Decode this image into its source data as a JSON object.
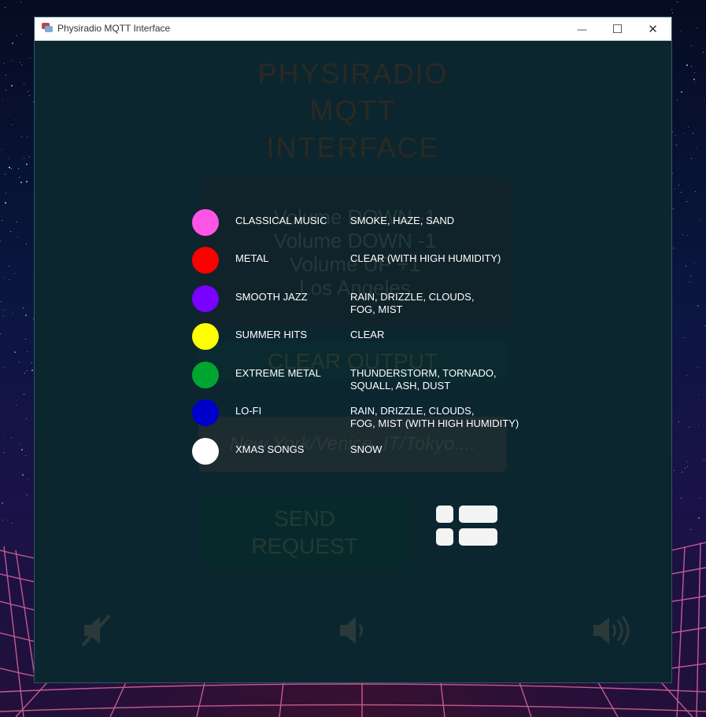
{
  "window": {
    "title": "Physiradio MQTT Interface",
    "minimize_glyph": "—",
    "maximize_glyph": "☐",
    "close_glyph": "✕"
  },
  "app": {
    "title_lines": [
      "PHYSIRADIO",
      "MQTT",
      "INTERFACE"
    ],
    "output_lines": [
      "Volume DOWN -1",
      "Volume DOWN -1",
      "Volume UP +1",
      "Los Angeles"
    ],
    "clear_button": "CLEAR OUTPUT",
    "city_input_placeholder": "New York/Venice, IT/Tokyo....",
    "send_button_lines": [
      "SEND",
      "REQUEST"
    ],
    "icons": {
      "mute": "volume-mute-icon",
      "down": "volume-down-icon",
      "up": "volume-up-icon",
      "legend_toggle": "list-view-icon"
    }
  },
  "legend": [
    {
      "color": "#ff55e6",
      "genre": "CLASSICAL MUSIC",
      "weather": "SMOKE, HAZE, SAND"
    },
    {
      "color": "#ff0000",
      "genre": "METAL",
      "weather": "CLEAR (WITH HIGH HUMIDITY)"
    },
    {
      "color": "#7a00ff",
      "genre": "SMOOTH JAZZ",
      "weather": "RAIN, DRIZZLE, CLOUDS,\nFOG, MIST"
    },
    {
      "color": "#ffff00",
      "genre": "SUMMER HITS",
      "weather": "CLEAR"
    },
    {
      "color": "#00a530",
      "genre": "EXTREME METAL",
      "weather": "THUNDERSTORM, TORNADO,\nSQUALL, ASH, DUST"
    },
    {
      "color": "#0000cc",
      "genre": "LO-FI",
      "weather": "RAIN, DRIZZLE, CLOUDS,\nFOG, MIST (WITH HIGH HUMIDITY)"
    },
    {
      "color": "#ffffff",
      "genre": "XMAS SONGS",
      "weather": "SNOW"
    }
  ]
}
